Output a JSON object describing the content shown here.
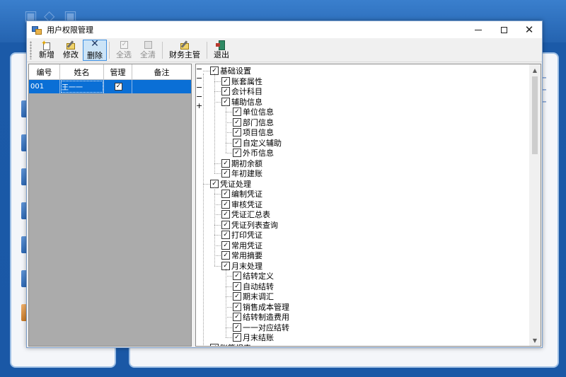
{
  "window": {
    "title": "用户权限管理",
    "minimize_label": "",
    "maximize_label": "",
    "close_label": "✕"
  },
  "toolbar": {
    "items": [
      {
        "label": "新增",
        "icon": "new-icon"
      },
      {
        "label": "修改",
        "icon": "edit-icon"
      },
      {
        "label": "删除",
        "icon": "delete-icon",
        "active": true
      },
      {
        "label": "全选",
        "icon": "select-all-icon",
        "disabled": true
      },
      {
        "label": "全清",
        "icon": "clear-all-icon",
        "disabled": true
      },
      {
        "label": "财务主管",
        "icon": "manager-icon"
      },
      {
        "label": "退出",
        "icon": "exit-icon"
      }
    ]
  },
  "grid": {
    "columns": [
      "编号",
      "姓名",
      "管理",
      "备注"
    ],
    "rows": [
      {
        "id": "001",
        "name": "王一一",
        "admin": true,
        "note": ""
      }
    ]
  },
  "tree": {
    "nodes": [
      "基础设置",
      "账套属性",
      "会计科目",
      "辅助信息",
      "单位信息",
      "部门信息",
      "项目信息",
      "自定义辅助",
      "外币信息",
      "期初余额",
      "年初建账",
      "凭证处理",
      "编制凭证",
      "审核凭证",
      "凭证汇总表",
      "凭证列表查询",
      "打印凭证",
      "常用凭证",
      "常用摘要",
      "月末处理",
      "结转定义",
      "自动结转",
      "期末调汇",
      "销售成本管理",
      "结转制造费用",
      "一一对应结转",
      "月末结账",
      "账簿报表"
    ]
  },
  "colors": {
    "selection": "#0a6fd6",
    "toolbar_active": "#cce4f7",
    "background_app": "#1d5fae"
  }
}
